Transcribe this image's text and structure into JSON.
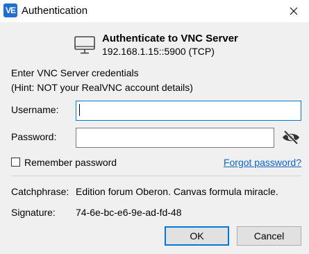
{
  "window": {
    "app_icon_text": "VE",
    "title": "Authentication"
  },
  "header": {
    "title": "Authenticate to VNC Server",
    "address": "192.168.1.15::5900 (TCP)"
  },
  "prompt": {
    "line1": "Enter VNC Server credentials",
    "line2": "(Hint: NOT your RealVNC account details)"
  },
  "form": {
    "username_label": "Username:",
    "username_value": "",
    "password_label": "Password:",
    "password_value": "",
    "remember_label": "Remember password",
    "remember_checked": false,
    "forgot_link": "Forgot password?"
  },
  "info": {
    "catchphrase_label": "Catchphrase:",
    "catchphrase_value": "Edition forum Oberon. Canvas formula miracle.",
    "signature_label": "Signature:",
    "signature_value": "74-6e-bc-e6-9e-ad-fd-48"
  },
  "buttons": {
    "ok": "OK",
    "cancel": "Cancel"
  },
  "icons": {
    "app": "realvnc-viewer-icon",
    "close": "close-icon",
    "header": "monitor-icon",
    "password_toggle": "eye-slash-icon"
  },
  "colors": {
    "focus_border": "#0078d7",
    "link": "#0b63c5",
    "app_icon_bg": "#1f6fd1"
  }
}
